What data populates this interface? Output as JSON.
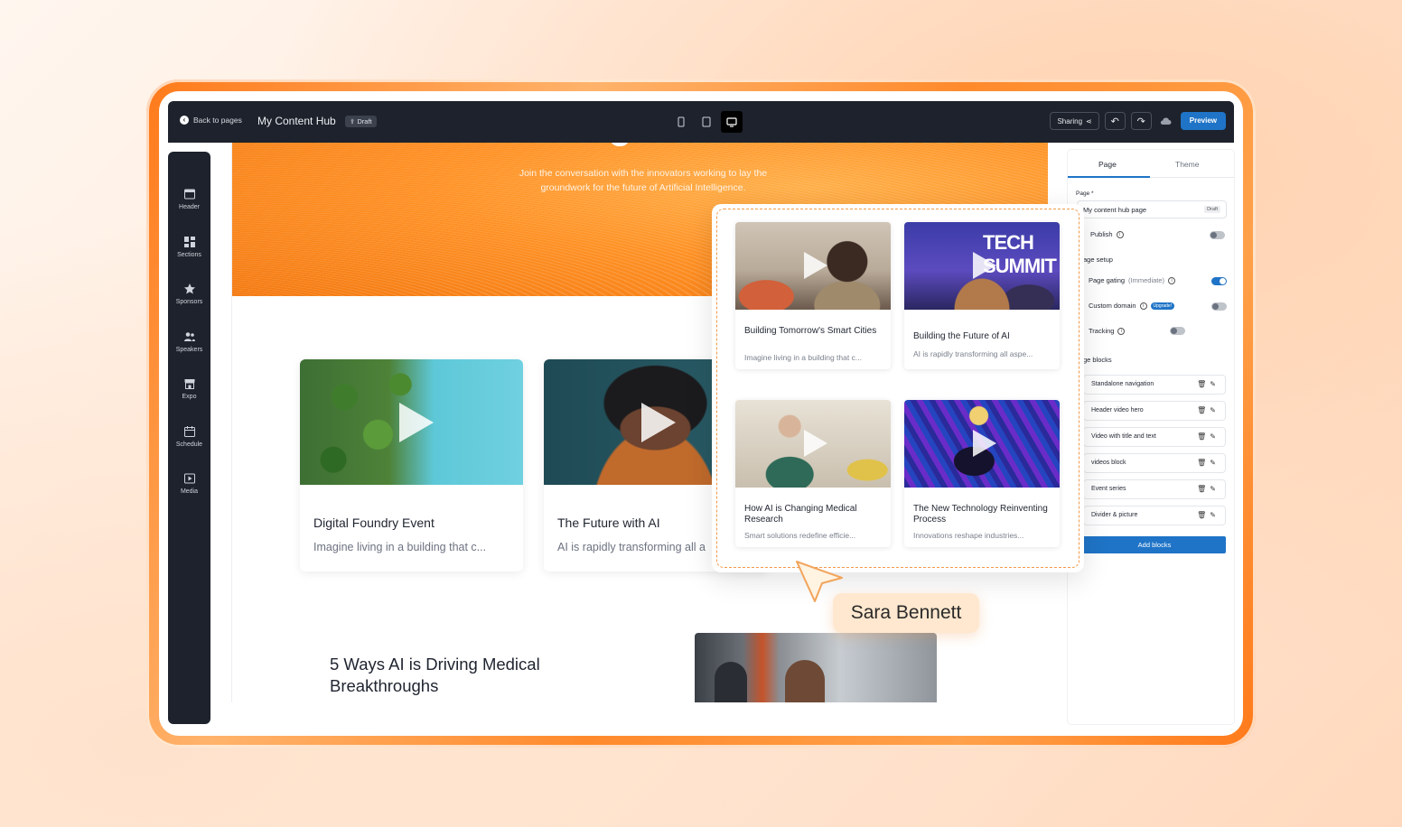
{
  "toolbar": {
    "back_label": "Back to pages",
    "title": "My Content Hub",
    "status_badge": "Draft",
    "sharing_label": "Sharing",
    "preview_label": "Preview",
    "active_device": "desktop"
  },
  "sidebar": {
    "items": [
      {
        "label": "Header",
        "icon": "header-icon"
      },
      {
        "label": "Sections",
        "icon": "sections-icon"
      },
      {
        "label": "Sponsors",
        "icon": "star-icon"
      },
      {
        "label": "Speakers",
        "icon": "people-icon"
      },
      {
        "label": "Expo",
        "icon": "booth-icon"
      },
      {
        "label": "Schedule",
        "icon": "calendar-icon"
      },
      {
        "label": "Media",
        "icon": "media-icon"
      }
    ]
  },
  "canvas": {
    "hero_subtitle": "Join the conversation with the innovators working to lay the groundwork for the future of Artificial Intelligence.",
    "cards": [
      {
        "title": "Digital Foundry Event",
        "desc": "Imagine living in a building that c..."
      },
      {
        "title": "The Future with AI",
        "desc": "AI is rapidly transforming all a"
      }
    ],
    "article_title": "5 Ways AI is Driving Medical Breakthroughs"
  },
  "popover": {
    "cards": [
      {
        "title": "Building Tomorrow's Smart Cities",
        "desc": "Imagine living in a building that c..."
      },
      {
        "title": "Building the Future of AI",
        "desc": "AI is rapidly transforming all aspe...",
        "image_text": "TECH SUMMIT"
      },
      {
        "title": "How AI is Changing Medical Research",
        "desc": "Smart solutions redefine efficie..."
      },
      {
        "title": "The New Technology Reinventing Process",
        "desc": "Innovations reshape industries..."
      }
    ]
  },
  "collaborator": {
    "name": "Sara Bennett"
  },
  "panel": {
    "tabs": [
      "Page",
      "Theme"
    ],
    "active_tab": "Page",
    "page_label": "Page *",
    "page_value": "My content hub page",
    "page_badge": "Draft",
    "publish_label": "Publish",
    "publish_on": false,
    "setup_heading": "age setup",
    "gating_label": "Page gating",
    "gating_mode": "(Immediate)",
    "gating_on": true,
    "domain_label": "Custom domain",
    "upgrade_badge": "Upgrade!",
    "domain_on": false,
    "tracking_label": "Tracking",
    "tracking_on": false,
    "blocks_heading": "ge blocks",
    "blocks": [
      "Standalone navigation",
      "Header video hero",
      "Video with title and text",
      "videos block",
      "Event series",
      "Divider & picture"
    ],
    "add_blocks_label": "Add blocks"
  }
}
